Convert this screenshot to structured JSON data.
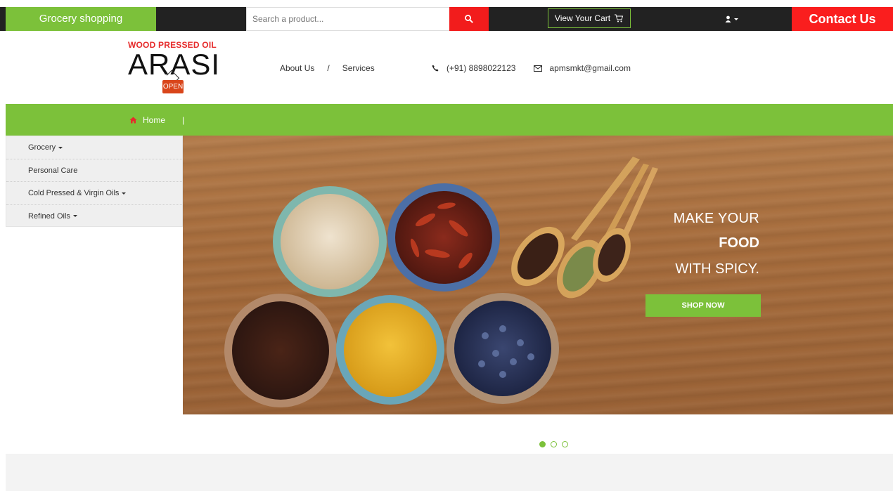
{
  "topbar": {
    "brand": "Grocery shopping",
    "search_placeholder": "Search a product...",
    "cart_label": "View Your Cart",
    "contact_label": "Contact Us"
  },
  "logo": {
    "tagline": "WOOD PRESSED OIL",
    "name": "ARASI",
    "sign": "OPEN"
  },
  "header_nav": {
    "about": "About Us",
    "separator": "/",
    "services": "Services",
    "phone": "(+91) 8898022123",
    "email": "apmsmkt@gmail.com"
  },
  "main_nav": {
    "home": "Home",
    "divider": "|"
  },
  "sidebar": {
    "items": [
      {
        "label": "Grocery",
        "dropdown": true
      },
      {
        "label": "Personal Care",
        "dropdown": false
      },
      {
        "label": "Cold Pressed & Virgin Oils",
        "dropdown": true
      },
      {
        "label": "Refined Oils",
        "dropdown": true
      }
    ]
  },
  "banner": {
    "line1": "MAKE YOUR",
    "line2": "FOOD",
    "line3": "WITH SPICY.",
    "cta": "SHOP NOW",
    "slides_total": 3,
    "active_slide": 1
  },
  "colors": {
    "accent_green": "#7cc13a",
    "accent_red": "#fa1e1e",
    "topbar_dark": "#222222"
  },
  "icons": {
    "search": "search-icon",
    "cart": "cart-icon",
    "user": "user-icon",
    "phone": "phone-icon",
    "email": "envelope-icon",
    "home": "home-icon"
  }
}
